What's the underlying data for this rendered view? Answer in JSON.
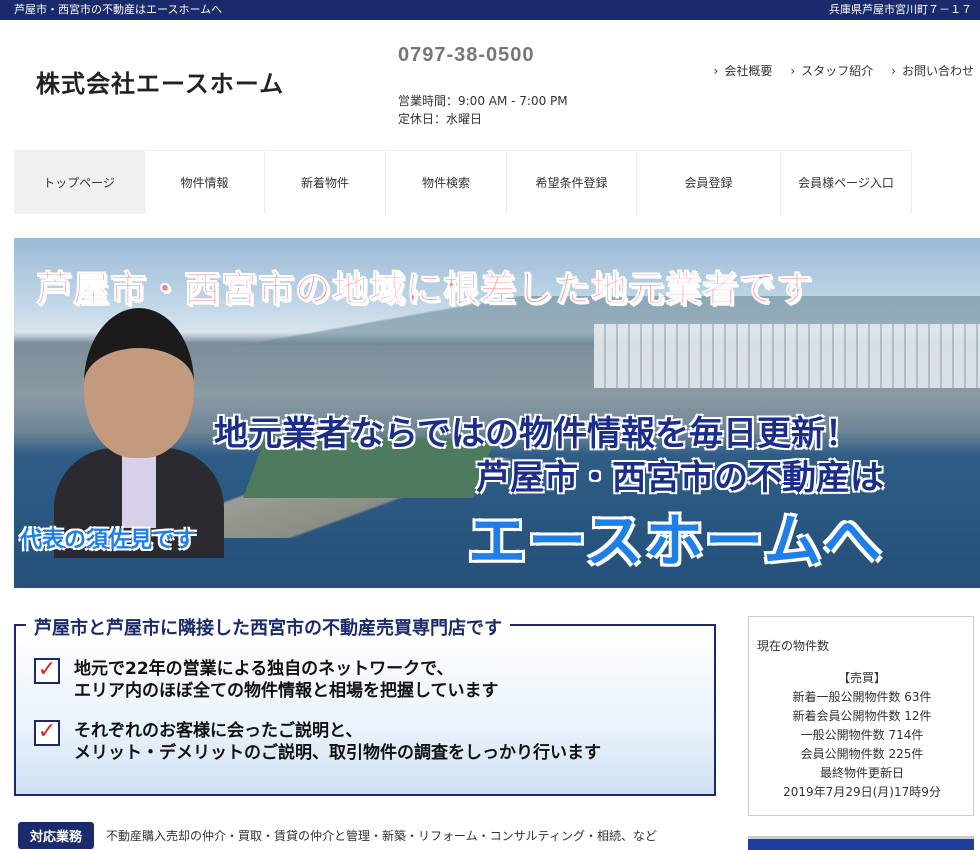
{
  "topbar": {
    "left": "芦屋市・西宮市の不動産はエースホームへ",
    "right": "兵庫県芦屋市宮川町７－１７"
  },
  "header": {
    "company": "株式会社エースホーム",
    "phone": "0797-38-0500",
    "hours": "営業時間：9:00 AM - 7:00 PM",
    "holiday": "定休日：水曜日",
    "links": [
      "会社概要",
      "スタッフ紹介",
      "お問い合わせ"
    ]
  },
  "nav": [
    "トップページ",
    "物件情報",
    "新着物件",
    "物件検索",
    "希望条件登録",
    "会員登録",
    "会員様ページ入口"
  ],
  "hero": {
    "headline": "芦屋市・西宮市の地域に根差した地元業者です",
    "line1": "地元業者ならではの物件情報を毎日更新！",
    "line2": "芦屋市・西宮市の不動産は",
    "line3": "エースホームへ",
    "caption": "代表の須佐見です"
  },
  "feature": {
    "title": "芦屋市と芦屋市に隣接した西宮市の不動産売買専門店です",
    "points": [
      {
        "l1": "地元で22年の営業による独自のネットワークで、",
        "l2": "エリア内のほぼ全ての物件情報と相場を把握しています"
      },
      {
        "l1": "それぞれのお客様に会ったご説明と、",
        "l2": "メリット・デメリットのご説明、取引物件の調査をしっかり行います"
      }
    ]
  },
  "service": {
    "badge": "対応業務",
    "text": "不動産購入売却の仲介・買取・賃貸の仲介と管理・新築・リフォーム・コンサルティング・相続、など"
  },
  "side": {
    "heading": "現在の物件数",
    "rows": [
      "【売買】",
      "新着一般公開物件数 63件",
      "新着会員公開物件数 12件",
      "一般公開物件数 714件",
      "会員公開物件数 225件",
      "最終物件更新日",
      "2019年7月29日(月)17時9分"
    ]
  }
}
